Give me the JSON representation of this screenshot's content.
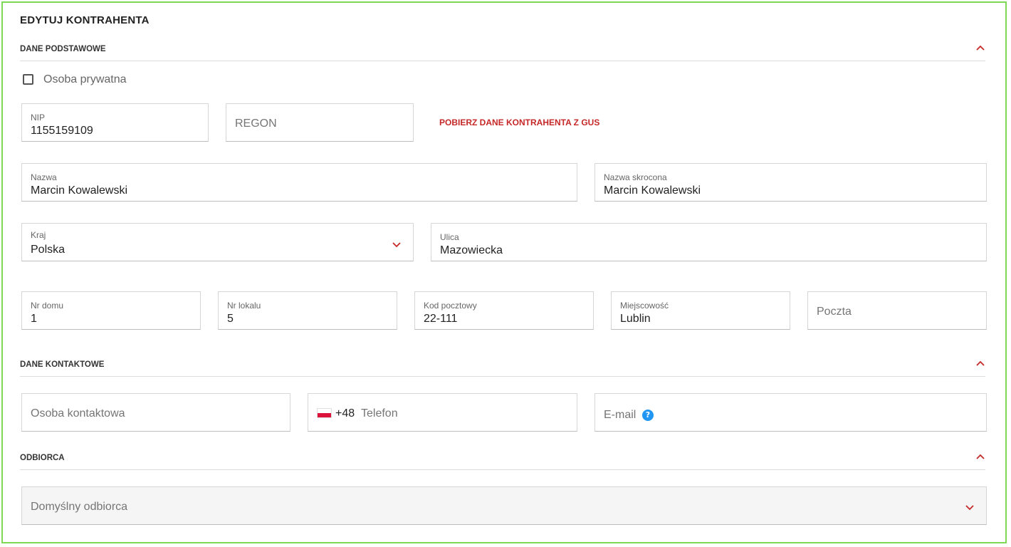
{
  "page": {
    "title": "EDYTUJ KONTRAHENTA"
  },
  "sections": {
    "basic": {
      "title": "DANE PODSTAWOWE"
    },
    "contact": {
      "title": "DANE KONTAKTOWE"
    },
    "recipient": {
      "title": "ODBIORCA"
    }
  },
  "basic": {
    "private_person_label": "Osoba prywatna",
    "private_person_checked": false,
    "nip": {
      "label": "NIP",
      "value": "1155159109"
    },
    "regon": {
      "placeholder": "REGON"
    },
    "gus_link": "POBIERZ DANE KONTRAHENTA Z GUS",
    "name": {
      "label": "Nazwa",
      "value": "Marcin Kowalewski"
    },
    "short_name": {
      "label": "Nazwa skrocona",
      "value": "Marcin Kowalewski"
    },
    "country": {
      "label": "Kraj",
      "value": "Polska"
    },
    "street": {
      "label": "Ulica",
      "value": "Mazowiecka"
    },
    "house_no": {
      "label": "Nr domu",
      "value": "1"
    },
    "unit_no": {
      "label": "Nr lokalu",
      "value": "5"
    },
    "postal_code": {
      "label": "Kod pocztowy",
      "value": "22-111"
    },
    "city": {
      "label": "Miejscowość",
      "value": "Lublin"
    },
    "post_office": {
      "placeholder": "Poczta"
    }
  },
  "contact": {
    "contact_person": {
      "placeholder": "Osoba kontaktowa"
    },
    "phone": {
      "flag_icon": "poland-flag-icon",
      "dial_code": "+48",
      "placeholder": "Telefon"
    },
    "email": {
      "placeholder": "E-mail",
      "help_icon": "?"
    }
  },
  "recipient": {
    "default_recipient": {
      "placeholder": "Domyślny odbiorca"
    }
  },
  "colors": {
    "accent": "#c62828",
    "frame": "#7ed957",
    "help": "#2196f3"
  }
}
